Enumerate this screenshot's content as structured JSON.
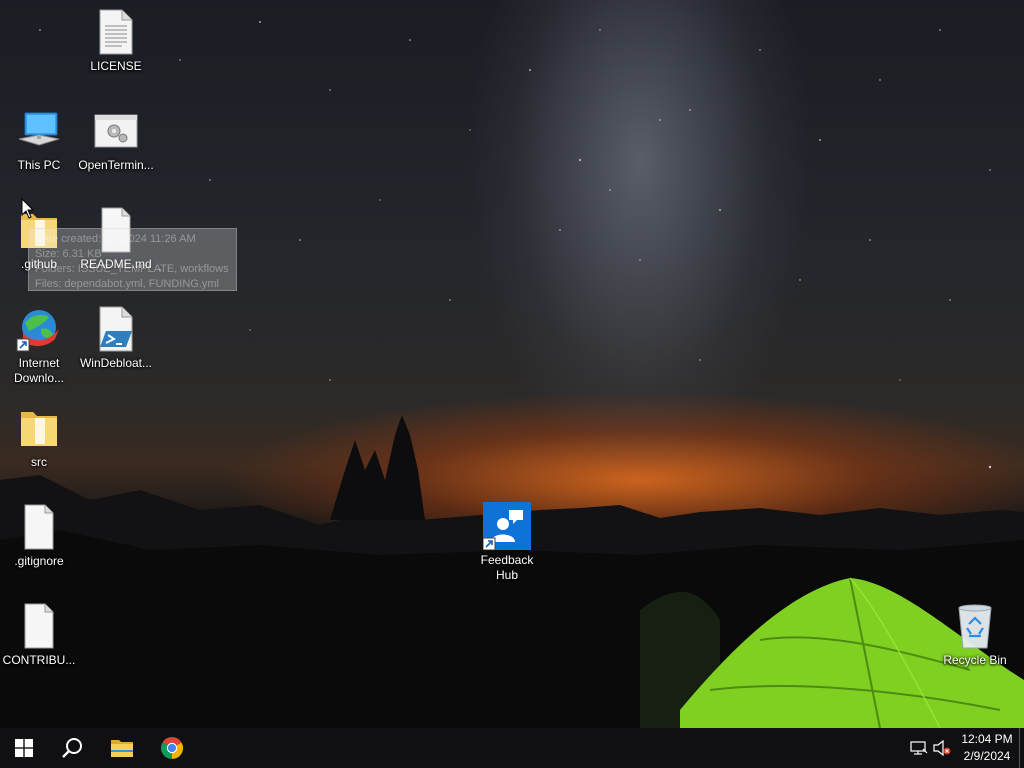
{
  "desktop": {
    "icons": [
      {
        "id": "license",
        "label": "LICENSE"
      },
      {
        "id": "this-pc",
        "label": "This PC"
      },
      {
        "id": "openterminal",
        "label": "OpenTermin..."
      },
      {
        "id": "github",
        "label": ".github"
      },
      {
        "id": "readme",
        "label": "README.md"
      },
      {
        "id": "idm",
        "label": "Internet Downlo..."
      },
      {
        "id": "windebloat",
        "label": "WinDebloat..."
      },
      {
        "id": "src",
        "label": "src"
      },
      {
        "id": "gitignore",
        "label": ".gitignore"
      },
      {
        "id": "contributing",
        "label": "CONTRIBU..."
      },
      {
        "id": "feedback-hub",
        "label": "Feedback Hub"
      },
      {
        "id": "recycle-bin",
        "label": "Recycle Bin"
      }
    ],
    "tooltip": {
      "line1": "Date created: 2/9/2024 11:26 AM",
      "line2": "Size: 6.31 KB",
      "line3": "Folders: ISSUE_TEMPLATE, workflows",
      "line4": "Files: dependabot.yml, FUNDING.yml"
    }
  },
  "taskbar": {
    "start": {
      "icon": "windows-logo-icon"
    },
    "search": {
      "icon": "search-icon"
    },
    "pinned": [
      {
        "id": "file-explorer",
        "icon": "folder-icon"
      },
      {
        "id": "chrome",
        "icon": "chrome-icon"
      }
    ],
    "tray": {
      "network_icon": "network-disconnected-icon",
      "volume_icon": "volume-muted-icon"
    },
    "clock": {
      "time": "12:04 PM",
      "date": "2/9/2024"
    }
  },
  "colors": {
    "taskbar": "#101012",
    "tent": "#7fd020",
    "sunset": "#e06e1e",
    "accent": "#0f72d6"
  }
}
